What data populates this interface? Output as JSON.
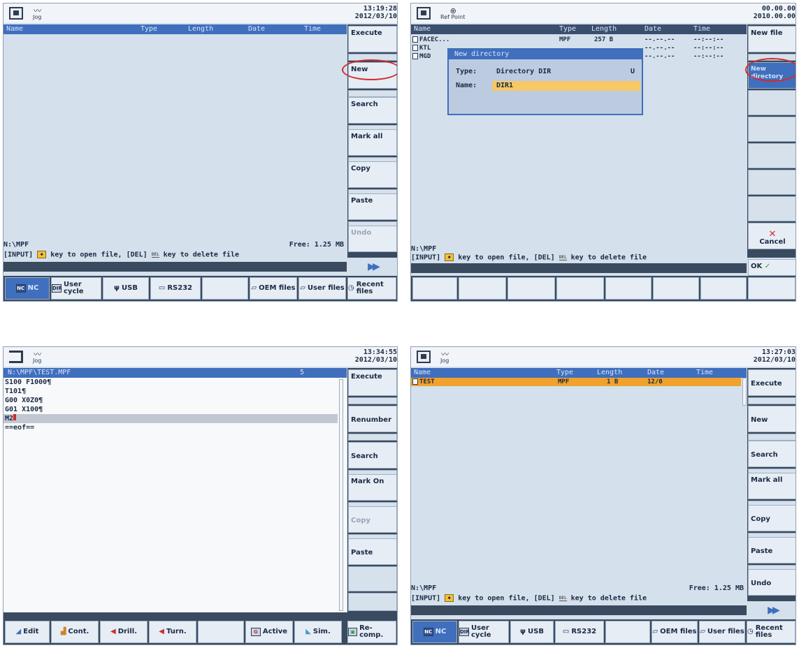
{
  "screens": {
    "tl": {
      "time": "13:19:28",
      "date": "2012/03/10",
      "mode": "Jog",
      "columns": [
        "Name",
        "Type",
        "Length",
        "Date",
        "Time"
      ],
      "softkeys": [
        "Execute",
        "New",
        "Search",
        "Mark all",
        "Copy",
        "Paste",
        "Undo"
      ],
      "path": "N:\\MPF",
      "free": "Free: 1.25 MB",
      "hint_a": "[INPUT]",
      "hint_b": "key to open file, [DEL]",
      "hint_c": "key to delete file",
      "bottom": [
        "NC",
        "User cycle",
        "USB",
        "RS232",
        "OEM files",
        "User files",
        "Recent files"
      ]
    },
    "tr": {
      "time": "00.00.00",
      "date": "2010.00.00",
      "mode": "Ref Point",
      "columns": [
        "Name",
        "Type",
        "Length",
        "Date",
        "Time"
      ],
      "files": [
        {
          "name": "FACEC...",
          "type": "MPF",
          "length": "257 B",
          "date": "--.--.--",
          "time": "--:--:--"
        },
        {
          "name": "KTL",
          "type": "",
          "length": "",
          "date": "--.--.--",
          "time": "--:--:--"
        },
        {
          "name": "MGD",
          "type": "",
          "length": "",
          "date": "--.--.--",
          "time": "--:--:--"
        }
      ],
      "dialog_title": "New directory",
      "type_label": "Type:",
      "type_value": "Directory DIR",
      "type_marker": "U",
      "name_label": "Name:",
      "name_value": "DIR1",
      "softkeys": [
        "New file",
        "New directory",
        "Cancel",
        "OK"
      ],
      "path": "N:\\MPF",
      "hint_a": "[INPUT]",
      "hint_b": "key to open file, [DEL]",
      "hint_c": "key to delete file"
    },
    "bl": {
      "time": "13:34:55",
      "date": "2012/03/10",
      "mode": "Jog",
      "path": "N:\\MPF\\TEST.MPF",
      "line_no": "5",
      "lines": [
        "S100 F1000¶",
        "T101¶",
        "G00 X0Z0¶",
        "G01 X100¶",
        "M2",
        "==eof=="
      ],
      "softkeys": [
        "Execute",
        "Renumber",
        "Search",
        "Mark On",
        "Copy",
        "Paste"
      ],
      "bottom": [
        "Edit",
        "Cont.",
        "Drill.",
        "Turn.",
        "Active",
        "Sim.",
        "Re- comp."
      ]
    },
    "br": {
      "time": "13:27:03",
      "date": "2012/03/10",
      "mode": "Jog",
      "columns": [
        "Name",
        "Type",
        "Length",
        "Date",
        "Time"
      ],
      "file": {
        "name": "TEST",
        "type": "MPF",
        "length": "1 B",
        "date": "12/0"
      },
      "softkeys": [
        "Execute",
        "New",
        "Search",
        "Mark all",
        "Copy",
        "Paste",
        "Undo"
      ],
      "path": "N:\\MPF",
      "free": "Free: 1.25 MB",
      "hint_a": "[INPUT]",
      "hint_b": "key to open file, [DEL]",
      "hint_c": "key to delete file",
      "bottom": [
        "NC",
        "User cycle",
        "USB",
        "RS232",
        "OEM files",
        "User files",
        "Recent files"
      ]
    }
  },
  "colors": {
    "header": "#3f6fbd",
    "highlight_row": "#f0a22c",
    "circle": "#d42a2a",
    "panel": "#d4e0ec"
  }
}
